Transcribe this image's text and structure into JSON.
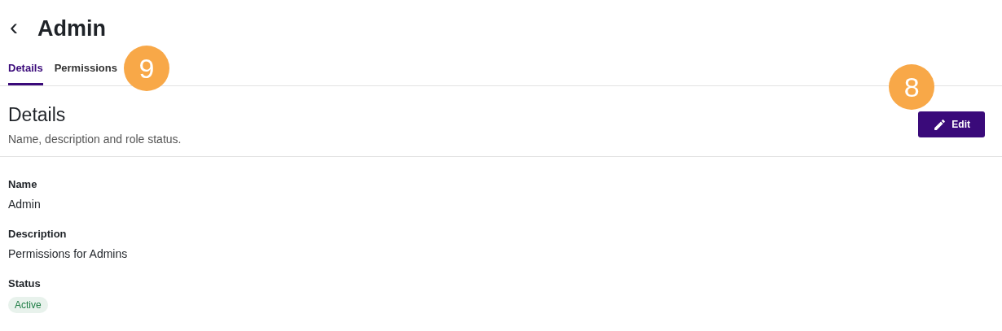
{
  "header": {
    "back": "‹",
    "title": "Admin"
  },
  "tabs": [
    {
      "label": "Details",
      "selected": true
    },
    {
      "label": "Permissions",
      "selected": false
    }
  ],
  "section": {
    "title": "Details",
    "subtitle": "Name, description and role status.",
    "edit_button": "Edit"
  },
  "fields": [
    {
      "kind": "text",
      "label": "Name",
      "value": "Admin"
    },
    {
      "kind": "text",
      "label": "Description",
      "value": "Permissions for Admins"
    },
    {
      "kind": "badge",
      "label": "Status",
      "value": "Active",
      "color": "#1e7d45"
    }
  ],
  "tabs_callout": "9",
  "edit_callout": "8"
}
